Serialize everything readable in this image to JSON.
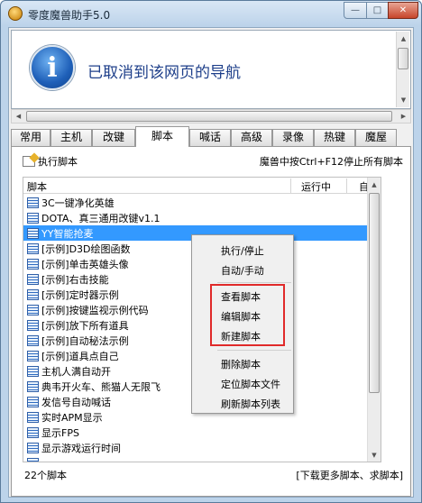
{
  "window": {
    "title": "零度魔兽助手5.0",
    "min_symbol": "—",
    "max_symbol": "□",
    "close_symbol": "✕"
  },
  "message": {
    "icon_symbol": "i",
    "text": "已取消到该网页的导航"
  },
  "tabs": [
    {
      "label": "常用"
    },
    {
      "label": "主机"
    },
    {
      "label": "改键"
    },
    {
      "label": "脚本"
    },
    {
      "label": "喊话"
    },
    {
      "label": "高级"
    },
    {
      "label": "录像"
    },
    {
      "label": "热键"
    },
    {
      "label": "魔屋"
    }
  ],
  "active_tab": "脚本",
  "toolbar": {
    "run_label": "执行脚本",
    "hint": "魔兽中按Ctrl+F12停止所有脚本"
  },
  "list": {
    "columns": [
      "脚本",
      "运行中",
      "自动"
    ],
    "rows": [
      "3C一键净化英雄",
      "DOTA、真三通用改键v1.1",
      "YY智能抢麦",
      "[示例]D3D绘图函数",
      "[示例]单击英雄头像",
      "[示例]右击技能",
      "[示例]定时器示例",
      "[示例]按键监视示例代码",
      "[示例]放下所有道具",
      "[示例]自动秘法示例",
      "[示例]道具点自己",
      "主机人满自动开",
      "典韦开火车、熊猫人无限飞",
      "发信号自动喊话",
      "实时APM显示",
      "显示FPS",
      "显示游戏运行时间",
      "……"
    ],
    "selected": "YY智能抢麦"
  },
  "footer": {
    "count": "22个脚本",
    "link": "[下载更多脚本、求脚本]"
  },
  "context_menu": {
    "items": [
      "执行/停止",
      "自动/手动",
      "查看脚本",
      "编辑脚本",
      "新建脚本",
      "删除脚本",
      "定位脚本文件",
      "刷新脚本列表"
    ]
  },
  "colors": {
    "selection": "#3399ff",
    "highlight_box": "#e02a2a",
    "message_text": "#1e3f8a"
  }
}
